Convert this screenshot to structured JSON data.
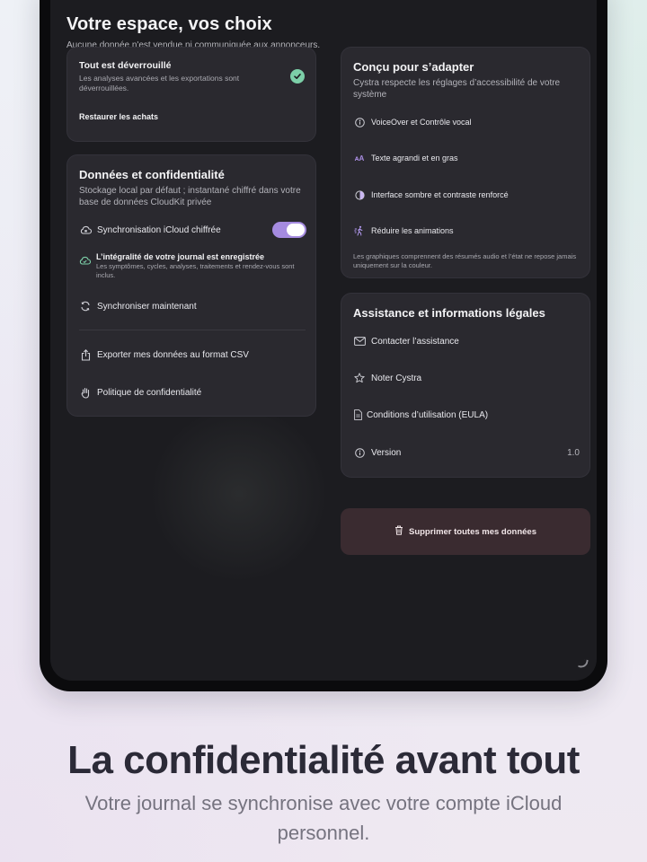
{
  "screen": {
    "title": "Votre espace, vos choix",
    "subtitle": "Aucune donnée n'est vendue ni communiquée aux annonceurs."
  },
  "unlock_card": {
    "title": "Tout est déverrouillé",
    "subtitle": "Les analyses avancées et les exportations sont déverrouillées.",
    "restore_label": "Restaurer les achats",
    "badge_icon": "check-badge-icon",
    "badge_color": "#7ccfa8"
  },
  "privacy_card": {
    "title": "Données et confidentialité",
    "subtitle": "Stockage local par défaut ; instantané chiffré dans votre base de données CloudKit privée",
    "icloud_sync_label": "Synchronisation iCloud chiffrée",
    "icloud_sync_on": true,
    "toggle_color": "#a58be0",
    "status_title": "L’intégralité de votre journal est enregistrée",
    "status_sub": "Les symptômes, cycles, analyses, traitements et rendez-vous sont inclus.",
    "sync_now_label": "Synchroniser maintenant",
    "export_label": "Exporter mes données au format CSV",
    "policy_label": "Politique de confidentialité"
  },
  "accessibility_card": {
    "title": "Conçu pour s’adapter",
    "subtitle": "Cystra respecte les réglages d’accessibilité de votre système",
    "items": [
      {
        "label": "VoiceOver et Contrôle vocal",
        "icon": "accessibility-icon"
      },
      {
        "label": "Texte agrandi et en gras",
        "icon": "text-size-icon"
      },
      {
        "label": "Interface sombre et contraste renforcé",
        "icon": "contrast-icon"
      },
      {
        "label": "Réduire les animations",
        "icon": "reduce-motion-icon"
      }
    ],
    "note": "Les graphiques comprennent des résumés audio et l’état ne repose jamais uniquement sur la couleur."
  },
  "support_card": {
    "title": "Assistance et informations légales",
    "contact_label": "Contacter l’assistance",
    "rate_label": "Noter Cystra",
    "terms_label": "Conditions d’utilisation (EULA)",
    "version_label": "Version",
    "version_value": "1.0"
  },
  "danger": {
    "delete_label": "Supprimer toutes mes données",
    "color": "#3a2b30"
  },
  "hero": {
    "headline": "La confidentialité avant tout",
    "tagline": "Votre journal se synchronise avec votre compte iCloud personnel."
  }
}
